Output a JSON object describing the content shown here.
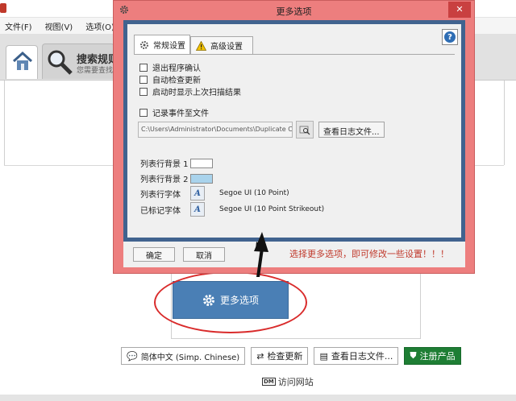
{
  "app": {
    "menu": [
      "文件(F)",
      "视图(V)",
      "选项(O)"
    ],
    "search_tab_title": "搜索规则",
    "search_tab_subtitle": "您需要查找",
    "more_options_button": "更多选项",
    "bottom_buttons": {
      "language": "简体中文 (Simp. Chinese)",
      "check_update": "检查更新",
      "view_log": "查看日志文件...",
      "register": "注册产品"
    },
    "visit_badge": "DM",
    "visit_site": "访问网站"
  },
  "dialog": {
    "title": "更多选项",
    "close_glyph": "✕",
    "help_glyph": "?",
    "tabs": {
      "general": "常规设置",
      "advanced": "高级设置"
    },
    "checkboxes": [
      "退出程序确认",
      "自动检查更新",
      "启动时显示上次扫描结果"
    ],
    "log_checkbox": "记录事件至文件",
    "log_path": "C:\\Users\\Administrator\\Documents\\Duplicate Cle",
    "view_log_button": "查看日志文件...",
    "row_bg1_label": "列表行背景 1",
    "row_bg2_label": "列表行背景 2",
    "list_font_label": "列表行字体",
    "list_font_value": "Segoe UI (10 Point)",
    "marked_font_label": "已标记字体",
    "marked_font_value": "Segoe UI (10 Point Strikeout)",
    "font_button_glyph": "A",
    "ok_button": "确定",
    "cancel_button": "取消"
  },
  "annotation": {
    "hint": "选择更多选项，即可修改一些设置！！！"
  },
  "colors": {
    "row_bg1": "#ffffff",
    "row_bg2": "#a9d3ec",
    "dialog_frame": "#ed7e7e",
    "accent_blue": "#4a7fb5",
    "register_green": "#1e7e34",
    "annotation_red": "#d92b2b"
  }
}
